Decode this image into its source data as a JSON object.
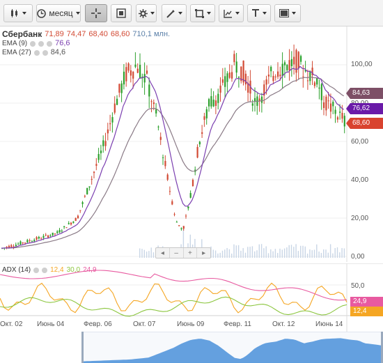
{
  "toolbar": {
    "period_label": "месяц",
    "buttons": [
      "chart-type",
      "period",
      "crosshair",
      "zoom",
      "settings",
      "draw-line",
      "shape",
      "indicators",
      "text",
      "image"
    ]
  },
  "legend": {
    "ticker": "Сбербанк",
    "open": "71,89",
    "high": "74,47",
    "low": "68,40",
    "close": "68,60",
    "volume": "710,1 млн.",
    "ema9_label": "EMA (9)",
    "ema9_value": "76,6",
    "ema27_label": "EMA (27)",
    "ema27_value": "84,6"
  },
  "price_axis": {
    "ticks": [
      "100,00",
      "80,00",
      "60,00",
      "40,00",
      "20,00",
      "0,00"
    ],
    "tags": {
      "ema27": "84,63",
      "ema9": "76,62",
      "last": "68,60"
    }
  },
  "adx": {
    "label": "ADX (14)",
    "v1": "12,4",
    "v2": "30,0",
    "v3": "24,9",
    "ticks": [
      "50,0"
    ],
    "tags": {
      "pink": "24,9",
      "orange": "12,4"
    }
  },
  "x_axis": {
    "labels": [
      "Окт. 02",
      "Июнь 04",
      "Февр. 06",
      "Окт. 07",
      "Июнь 09",
      "Февр. 11",
      "Окт. 12",
      "Июнь 14"
    ]
  },
  "scroll_controls": [
    "◂",
    "–",
    "+",
    "▸"
  ],
  "colors": {
    "up": "#2ca02c",
    "down": "#d24a34",
    "ema9": "#7b3fb0",
    "ema27": "#7d4f66",
    "adx_orange": "#f5a623",
    "adx_green": "#8cc63f",
    "adx_pink": "#e85aa0",
    "navigator": "#4a90d9"
  }
}
